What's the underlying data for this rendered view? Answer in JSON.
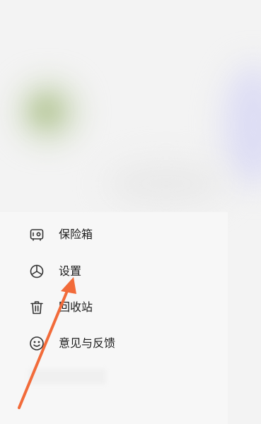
{
  "menu": {
    "items": [
      {
        "label": "保险箱",
        "icon": "safe-icon"
      },
      {
        "label": "设置",
        "icon": "settings-icon"
      },
      {
        "label": "回收站",
        "icon": "trash-icon"
      },
      {
        "label": "意见与反馈",
        "icon": "smile-icon"
      }
    ]
  },
  "colors": {
    "text": "#1c1c1c",
    "icon": "#333333",
    "arrow": "#f26b3a",
    "drawer_bg": "#f7f7f7"
  }
}
